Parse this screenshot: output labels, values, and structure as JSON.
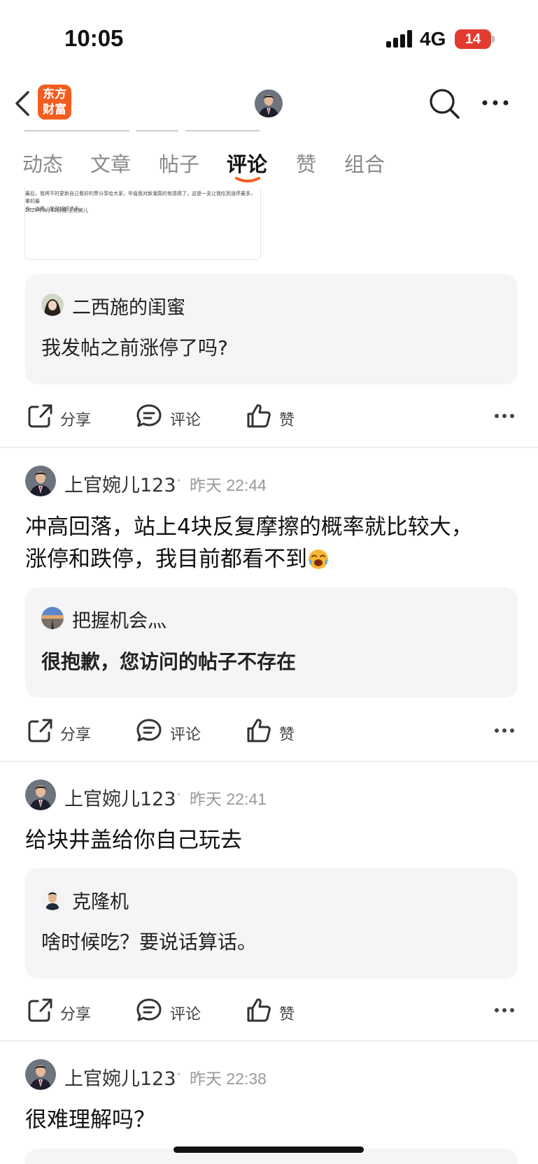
{
  "status_bar": {
    "time": "10:05",
    "network": "4G",
    "battery": "14"
  },
  "nav": {
    "logo_line1": "东方",
    "logo_line2": "财富",
    "icons": [
      "back-icon",
      "avatar",
      "search-icon",
      "more-icon"
    ]
  },
  "tabs": [
    {
      "label": "动态",
      "active": false
    },
    {
      "label": "文章",
      "active": false
    },
    {
      "label": "帖子",
      "active": false
    },
    {
      "label": "评论",
      "active": true
    },
    {
      "label": "赞",
      "active": false
    },
    {
      "label": "组合",
      "active": false
    }
  ],
  "preview": {
    "text": "最后，我将不时更新自己看好的票分享给大家，毕竟我对新潮真的有感情了，这是一支让我吃到涨停最多，拿的最",
    "text2": "作一支票。我是超短选手。",
    "date": "2025年8月12日晚-上官婉儿"
  },
  "actions": {
    "share": "分享",
    "comment": "评论",
    "like": "赞"
  },
  "comments": [
    {
      "quote": {
        "name": "二西施的闺蜜",
        "text": "我发帖之前涨停了吗?"
      }
    },
    {
      "user": "上官婉儿123",
      "sep": "·",
      "time": "昨天 22:44",
      "lines": [
        "冲高回落，站上4块反复摩擦的概率就比较大，",
        "涨停和跌停，我目前都看不到"
      ],
      "quote": {
        "name": "把握机会灬",
        "text": "很抱歉，您访问的帖子不存在"
      }
    },
    {
      "user": "上官婉儿123",
      "sep": "·",
      "time": "昨天 22:41",
      "lines": [
        "给块井盖给你自己玩去"
      ],
      "quote": {
        "name": "克隆机",
        "text": "啥时候吃？要说话算话。"
      }
    },
    {
      "user": "上官婉儿123",
      "sep": "·",
      "time": "昨天 22:38",
      "lines": [
        "很难理解吗？"
      ]
    }
  ],
  "colors": {
    "accent": "#f25d1f",
    "badge": "#e23b2f",
    "quote_bg": "#f5f5f7"
  }
}
